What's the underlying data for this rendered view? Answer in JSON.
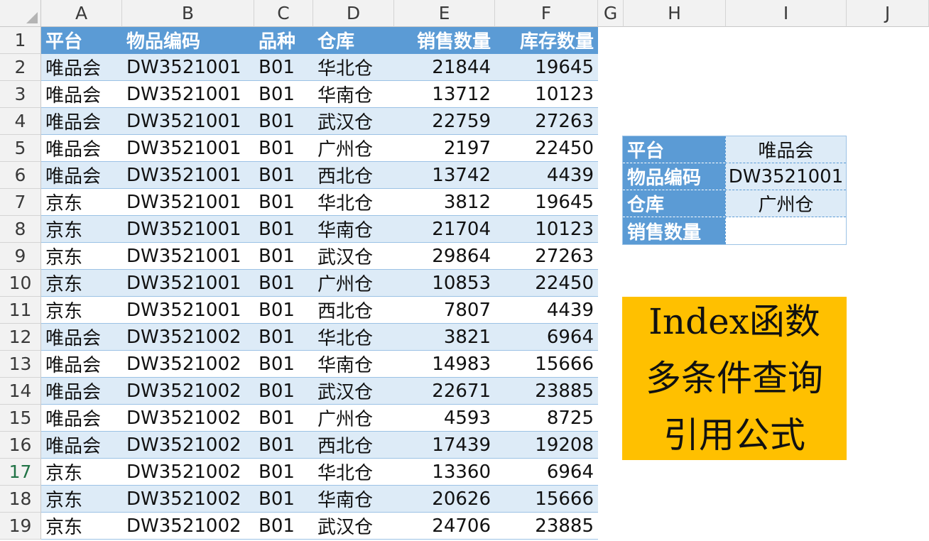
{
  "column_headers": [
    "A",
    "B",
    "C",
    "D",
    "E",
    "F",
    "G",
    "H",
    "I",
    "J"
  ],
  "table": {
    "headers": [
      "平台",
      "物品编码",
      "品种",
      "仓库",
      "销售数量",
      "库存数量"
    ],
    "rows": [
      [
        "唯品会",
        "DW3521001",
        "B01",
        "华北仓",
        "21844",
        "19645"
      ],
      [
        "唯品会",
        "DW3521001",
        "B01",
        "华南仓",
        "13712",
        "10123"
      ],
      [
        "唯品会",
        "DW3521001",
        "B01",
        "武汉仓",
        "22759",
        "27263"
      ],
      [
        "唯品会",
        "DW3521001",
        "B01",
        "广州仓",
        "2197",
        "22450"
      ],
      [
        "唯品会",
        "DW3521001",
        "B01",
        "西北仓",
        "13742",
        "4439"
      ],
      [
        "京东",
        "DW3521001",
        "B01",
        "华北仓",
        "3812",
        "19645"
      ],
      [
        "京东",
        "DW3521001",
        "B01",
        "华南仓",
        "21704",
        "10123"
      ],
      [
        "京东",
        "DW3521001",
        "B01",
        "武汉仓",
        "29864",
        "27263"
      ],
      [
        "京东",
        "DW3521001",
        "B01",
        "广州仓",
        "10853",
        "22450"
      ],
      [
        "京东",
        "DW3521001",
        "B01",
        "西北仓",
        "7807",
        "4439"
      ],
      [
        "唯品会",
        "DW3521002",
        "B01",
        "华北仓",
        "3821",
        "6964"
      ],
      [
        "唯品会",
        "DW3521002",
        "B01",
        "华南仓",
        "14983",
        "15666"
      ],
      [
        "唯品会",
        "DW3521002",
        "B01",
        "武汉仓",
        "22671",
        "23885"
      ],
      [
        "唯品会",
        "DW3521002",
        "B01",
        "广州仓",
        "4593",
        "8725"
      ],
      [
        "唯品会",
        "DW3521002",
        "B01",
        "西北仓",
        "17439",
        "19208"
      ],
      [
        "京东",
        "DW3521002",
        "B01",
        "华北仓",
        "13360",
        "6964"
      ],
      [
        "京东",
        "DW3521002",
        "B01",
        "华南仓",
        "20626",
        "15666"
      ],
      [
        "京东",
        "DW3521002",
        "B01",
        "武汉仓",
        "24706",
        "23885"
      ]
    ]
  },
  "row_numbers": [
    "1",
    "2",
    "3",
    "4",
    "5",
    "6",
    "7",
    "8",
    "9",
    "10",
    "11",
    "12",
    "13",
    "14",
    "15",
    "16",
    "17",
    "18",
    "19"
  ],
  "selected_row": "17",
  "lookup": {
    "rows": [
      {
        "label": "平台",
        "value": "唯品会"
      },
      {
        "label": "物品编码",
        "value": "DW3521001"
      },
      {
        "label": "仓库",
        "value": "广州仓"
      },
      {
        "label": "销售数量",
        "value": ""
      }
    ]
  },
  "title_box": {
    "lines": [
      "Index函数",
      "多条件查询",
      "引用公式"
    ]
  },
  "colors": {
    "header_fill": "#5b9bd5",
    "band_fill": "#ddebf7",
    "title_fill": "#ffc000",
    "selected_row_text": "#217346"
  }
}
